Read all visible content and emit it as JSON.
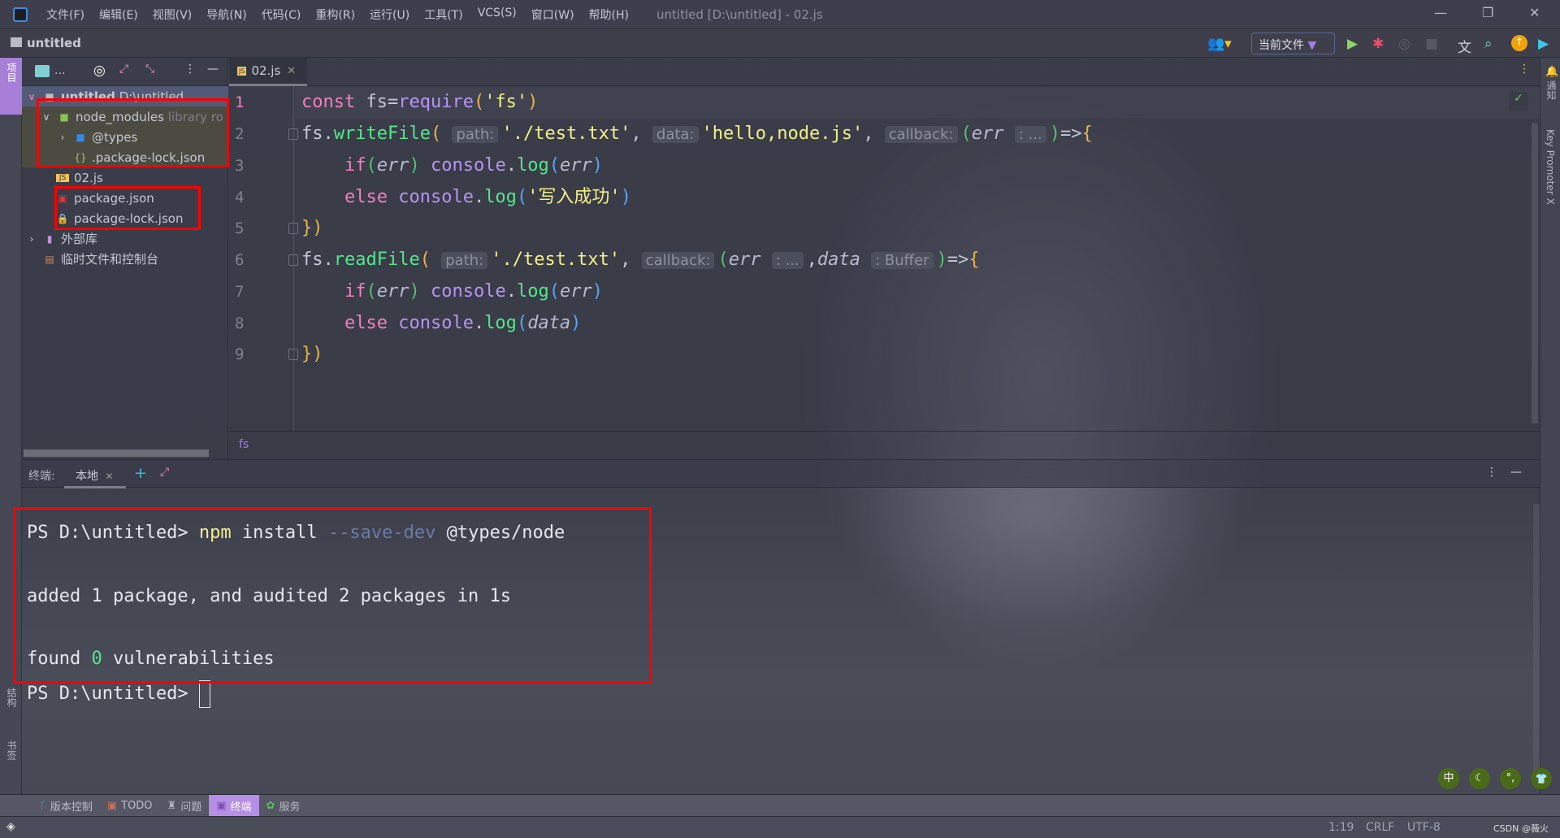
{
  "titlebar": {
    "menus": [
      "文件(F)",
      "编辑(E)",
      "视图(V)",
      "导航(N)",
      "代码(C)",
      "重构(R)",
      "运行(U)",
      "工具(T)",
      "VCS(S)",
      "窗口(W)",
      "帮助(H)"
    ],
    "title": "untitled [D:\\untitled] - 02.js"
  },
  "navbar": {
    "project": "untitled",
    "run_config": "当前文件"
  },
  "left_stripe": {
    "top": "项目",
    "bottom": [
      "结构",
      "书签"
    ]
  },
  "right_stripe": {
    "items": [
      "通知",
      "Key Promoter X"
    ]
  },
  "project": {
    "toolbar_label": "...",
    "tree": [
      {
        "label": "untitled",
        "suffix": "D:\\untitled",
        "icon": "folder-icon",
        "level": 0,
        "expanded": true
      },
      {
        "label": "node_modules",
        "suffix": "library ro",
        "icon": "node-folder-icon",
        "level": 1,
        "expanded": true
      },
      {
        "label": "@types",
        "icon": "ts-folder-icon",
        "level": 2,
        "expanded": false
      },
      {
        "label": ".package-lock.json",
        "icon": "json-icon",
        "level": 2
      },
      {
        "label": "02.js",
        "icon": "js-icon",
        "level": 1
      },
      {
        "label": "package.json",
        "icon": "npm-icon",
        "level": 1
      },
      {
        "label": "package-lock.json",
        "icon": "lock-icon",
        "level": 1
      },
      {
        "label": "外部库",
        "icon": "library-icon",
        "level": 0,
        "expanded": false
      },
      {
        "label": "临时文件和控制台",
        "icon": "scratch-icon",
        "level": 0
      }
    ]
  },
  "editor": {
    "tab": "02.js",
    "line_numbers": [
      "1",
      "2",
      "3",
      "4",
      "5",
      "6",
      "7",
      "8",
      "9"
    ],
    "breadcrumb": "fs",
    "hints": {
      "path": "path:",
      "data": "data:",
      "callback": "callback:",
      "ellipsis": ": ...",
      "buffer": ": Buffer"
    }
  },
  "terminal": {
    "label": "终端:",
    "tab": "本地",
    "lines": {
      "prompt": "PS D:\\untitled> ",
      "cmd": "npm",
      "arg1": " install ",
      "flag": "--save-dev",
      "arg2": " @types/node",
      "added": "added 1 package, and audited 2 packages in 1s",
      "found_pre": "found ",
      "found_num": "0",
      "found_post": " vulnerabilities",
      "prompt2": "PS D:\\untitled> "
    }
  },
  "bottom_tabs": [
    {
      "label": "版本控制"
    },
    {
      "label": "TODO"
    },
    {
      "label": "问题"
    },
    {
      "label": "终端",
      "active": true
    },
    {
      "label": "服务"
    }
  ],
  "status": {
    "position": "1:19",
    "line_sep": "CRLF",
    "encoding": "UTF-8",
    "watermark": "CSDN @薇火"
  },
  "ime": [
    "中",
    "☾",
    "°,",
    "👕"
  ],
  "colors": {
    "accent": "#b58ee6",
    "highlight_box": "#ff0000"
  }
}
